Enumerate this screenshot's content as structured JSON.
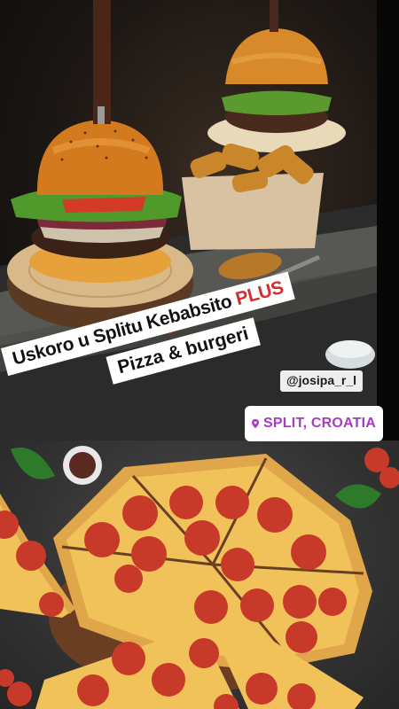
{
  "story": {
    "headline": {
      "line1_text": "Uskoro u Splitu Kebabsito ",
      "line1_accent": "PLUS",
      "line2_text": "Pizza & burgeri"
    },
    "mention": "@josipa_r_l",
    "location": "SPLIT, CROATIA",
    "colors": {
      "accent_red": "#d32f2f",
      "location_purple": "#a83ac6",
      "sticker_bg": "#ffffff"
    },
    "icons": [
      "location-pin-icon"
    ]
  }
}
